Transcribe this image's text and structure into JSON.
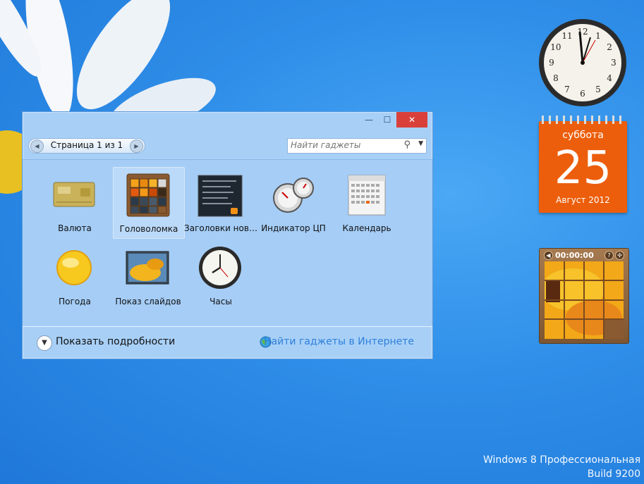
{
  "window": {
    "buttons": {
      "minimize": "—",
      "maximize": "☐",
      "close": "✕"
    },
    "pager": {
      "label": "Страница 1 из 1",
      "prev": "◀",
      "next": "▶"
    },
    "search": {
      "placeholder": "Найти гаджеты",
      "icon": "search-icon",
      "dropdown": "▼"
    },
    "gadgets": [
      {
        "label": "Валюта",
        "icon": "currency-card-icon"
      },
      {
        "label": "Головоломка",
        "icon": "picture-puzzle-icon",
        "selected": true
      },
      {
        "label": "Заголовки нов…",
        "icon": "feed-headlines-icon"
      },
      {
        "label": "Индикатор ЦП",
        "icon": "cpu-meter-icon"
      },
      {
        "label": "Календарь",
        "icon": "calendar-icon"
      },
      {
        "label": "Погода",
        "icon": "weather-sun-icon"
      },
      {
        "label": "Показ слайдов",
        "icon": "slideshow-icon"
      },
      {
        "label": "Часы",
        "icon": "clock-icon"
      }
    ],
    "footer": {
      "details_label": "Показать подробности",
      "details_icon": "chevron-down-icon",
      "online_link": "Найти гаджеты в Интернете",
      "online_icon": "globe-icon"
    }
  },
  "desktop": {
    "clock": {
      "numerals": [
        "12",
        "1",
        "2",
        "3",
        "4",
        "5",
        "6",
        "7",
        "8",
        "9",
        "10",
        "11"
      ]
    },
    "calendar": {
      "weekday": "суббота",
      "day": "25",
      "month_year": "Август 2012"
    },
    "puzzle": {
      "timer": "00:00:00",
      "back": "◀",
      "help": "?",
      "shuffle": "✣"
    },
    "watermark": {
      "line1": "Windows 8 Профессиональная",
      "line2": "Build 9200"
    }
  },
  "colors": {
    "window_bg": "#a8d0f7",
    "close": "#d9403a",
    "calendar": "#ec5e0c",
    "link": "#2f7fd9"
  }
}
